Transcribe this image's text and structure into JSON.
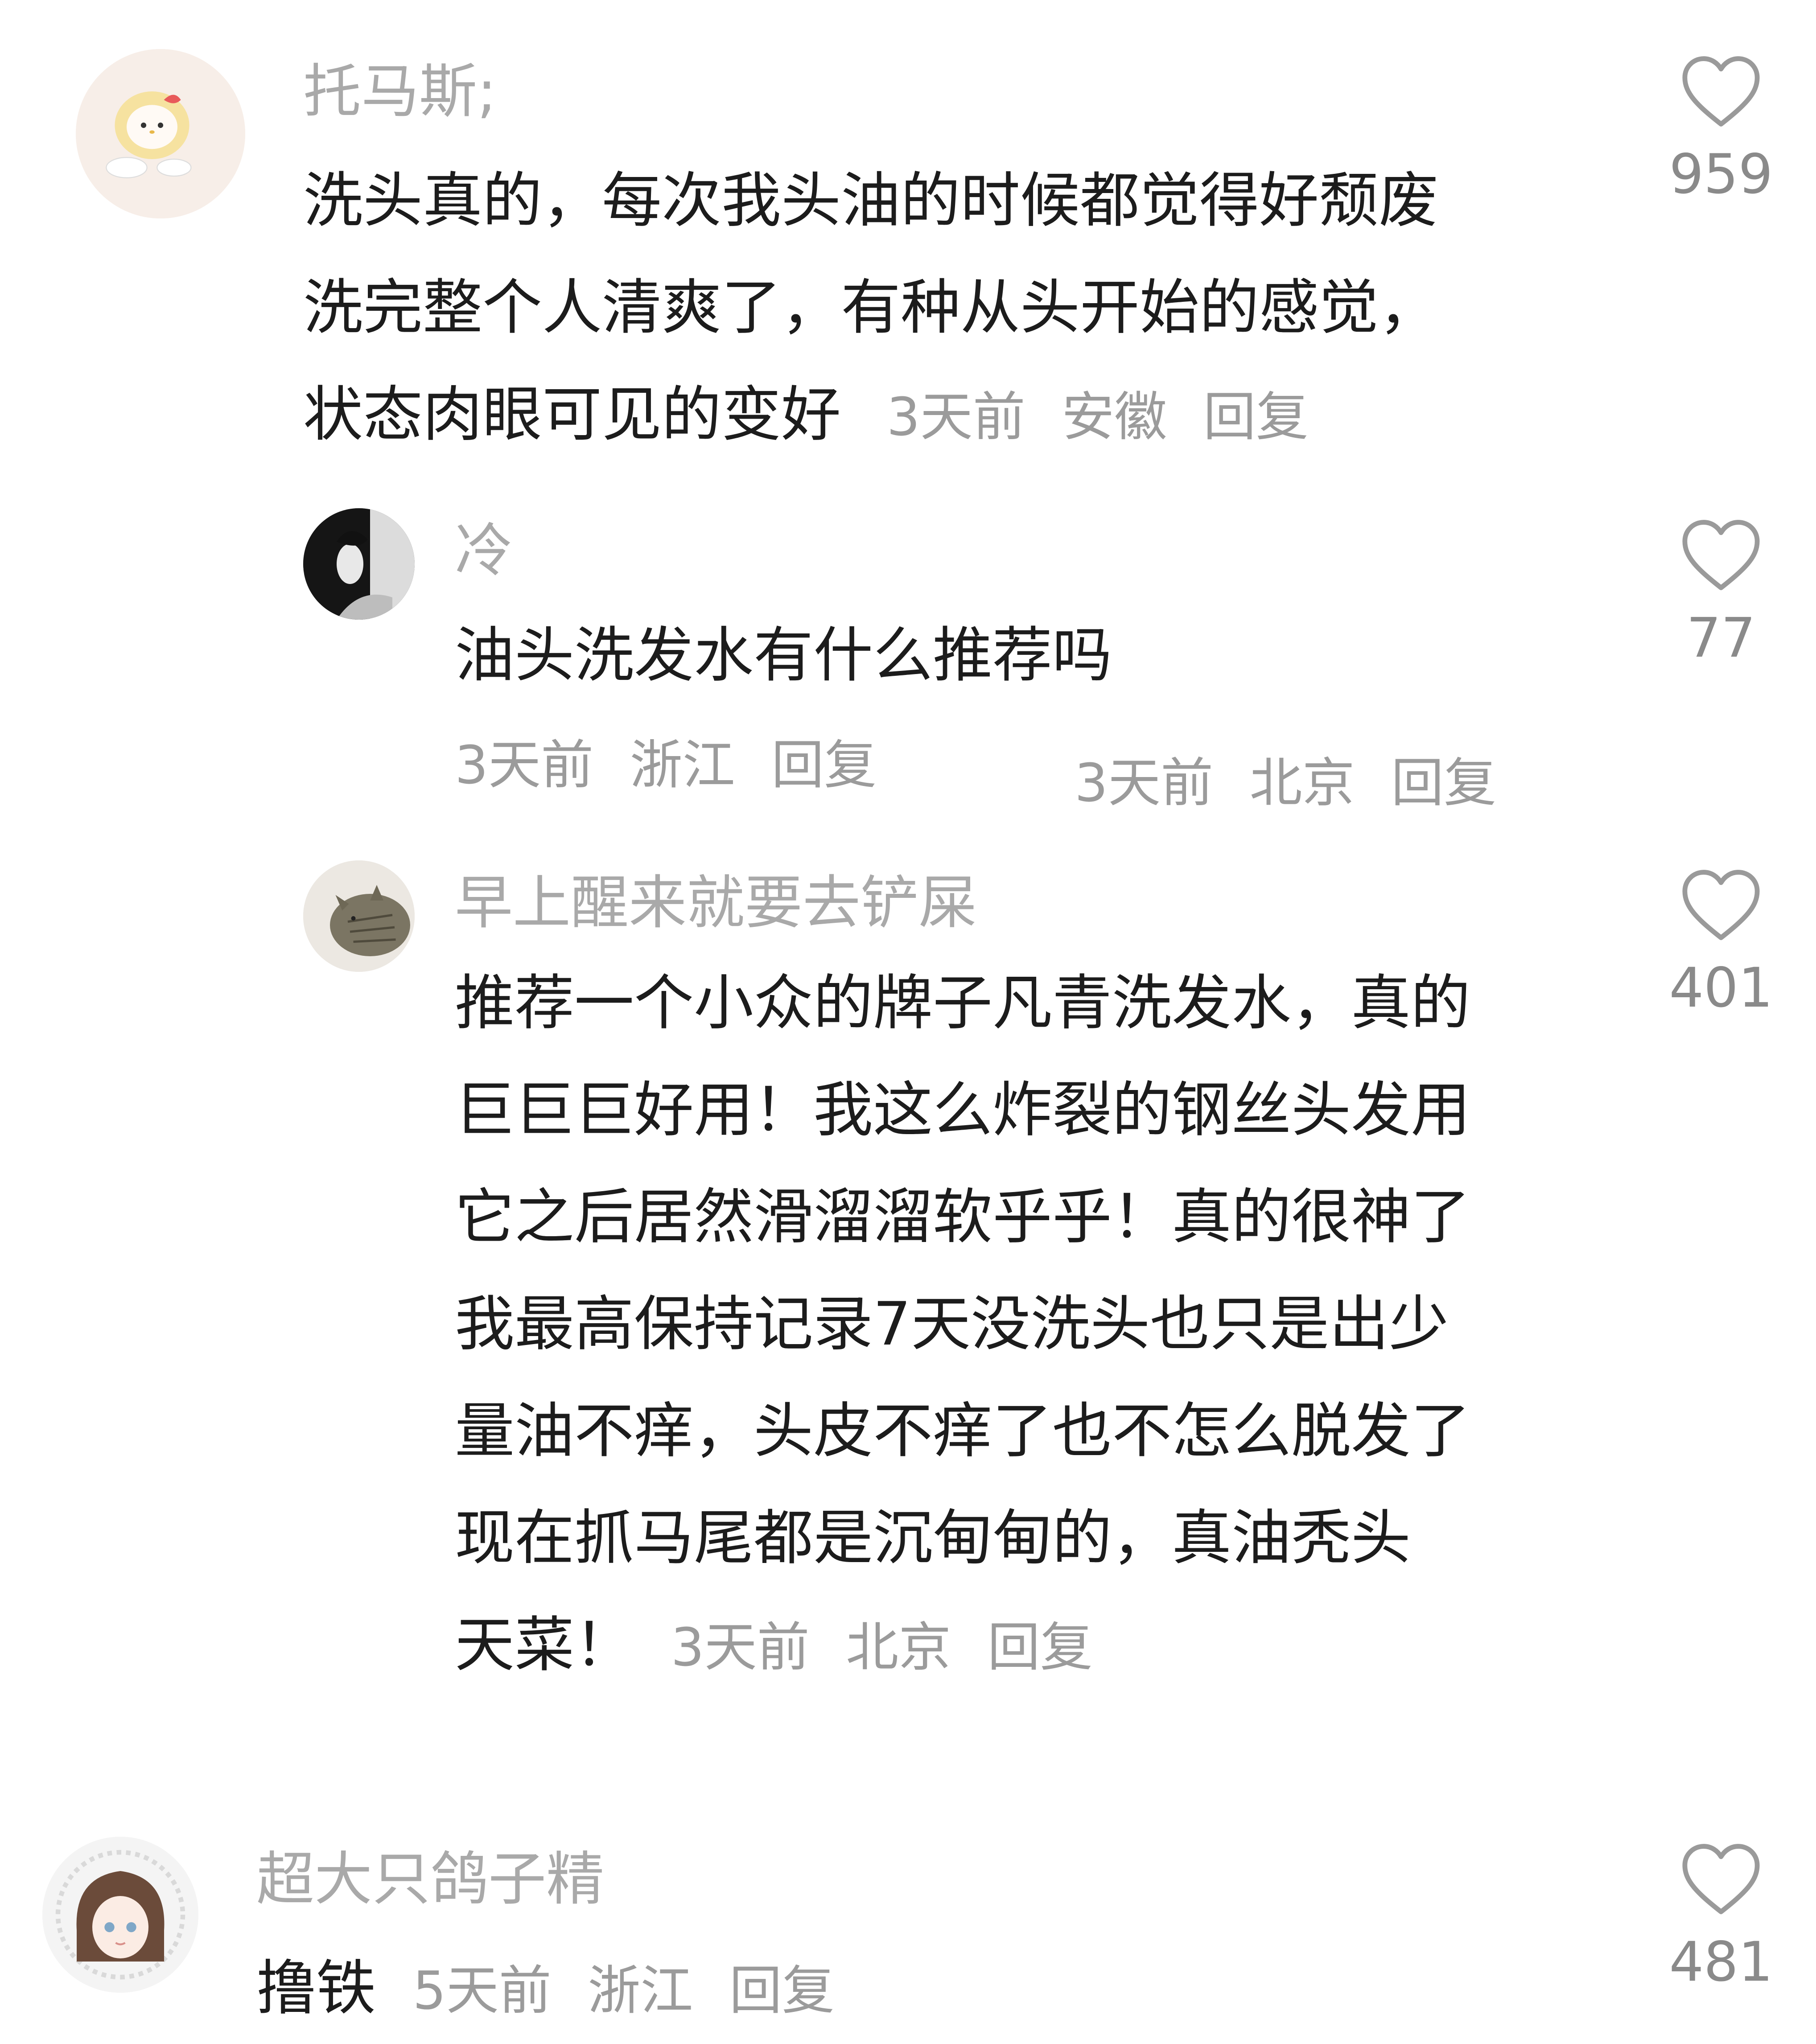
{
  "comments": [
    {
      "username": "托马斯;",
      "text_lines": [
        "洗头真的，每次我头油的时候都觉得好颓废",
        "洗完整个人清爽了，有种从头开始的感觉，",
        "状态肉眼可见的变好"
      ],
      "time": "3天前",
      "location": "安徽",
      "reply_label": "回复",
      "likes": "959"
    },
    {
      "username": "冷",
      "text_lines": [
        "油头洗发水有什么推荐吗"
      ],
      "time": "3天前",
      "location": "浙江",
      "reply_label": "回复",
      "likes": "77"
    },
    {
      "username": "早上醒来就要去铲屎",
      "text_lines": [
        "推荐一个小众的牌子凡青洗发水，真的",
        "巨巨巨好用！我这么炸裂的钢丝头发用",
        "它之后居然滑溜溜软乎乎！真的很神了",
        "我最高保持记录7天没洗头也只是出少",
        "量油不痒，头皮不痒了也不怎么脱发了",
        "现在抓马尾都是沉甸甸的，真油秃头",
        "天菜！"
      ],
      "time": "3天前",
      "location": "北京",
      "reply_label": "回复",
      "likes": "401"
    },
    {
      "username": "超大只鸽子精",
      "text_lines": [
        "撸铁"
      ],
      "time": "5天前",
      "location": "浙江",
      "reply_label": "回复",
      "likes": "481"
    }
  ],
  "stray_meta": {
    "time": "3天前",
    "location": "北京",
    "reply_label": "回复"
  },
  "icons": {
    "like": "heart-outline-icon"
  },
  "colors": {
    "username": "#a9a9a9",
    "meta": "#9b9b9b",
    "text": "#1c1c1c",
    "like_count": "#8a8a8a"
  }
}
